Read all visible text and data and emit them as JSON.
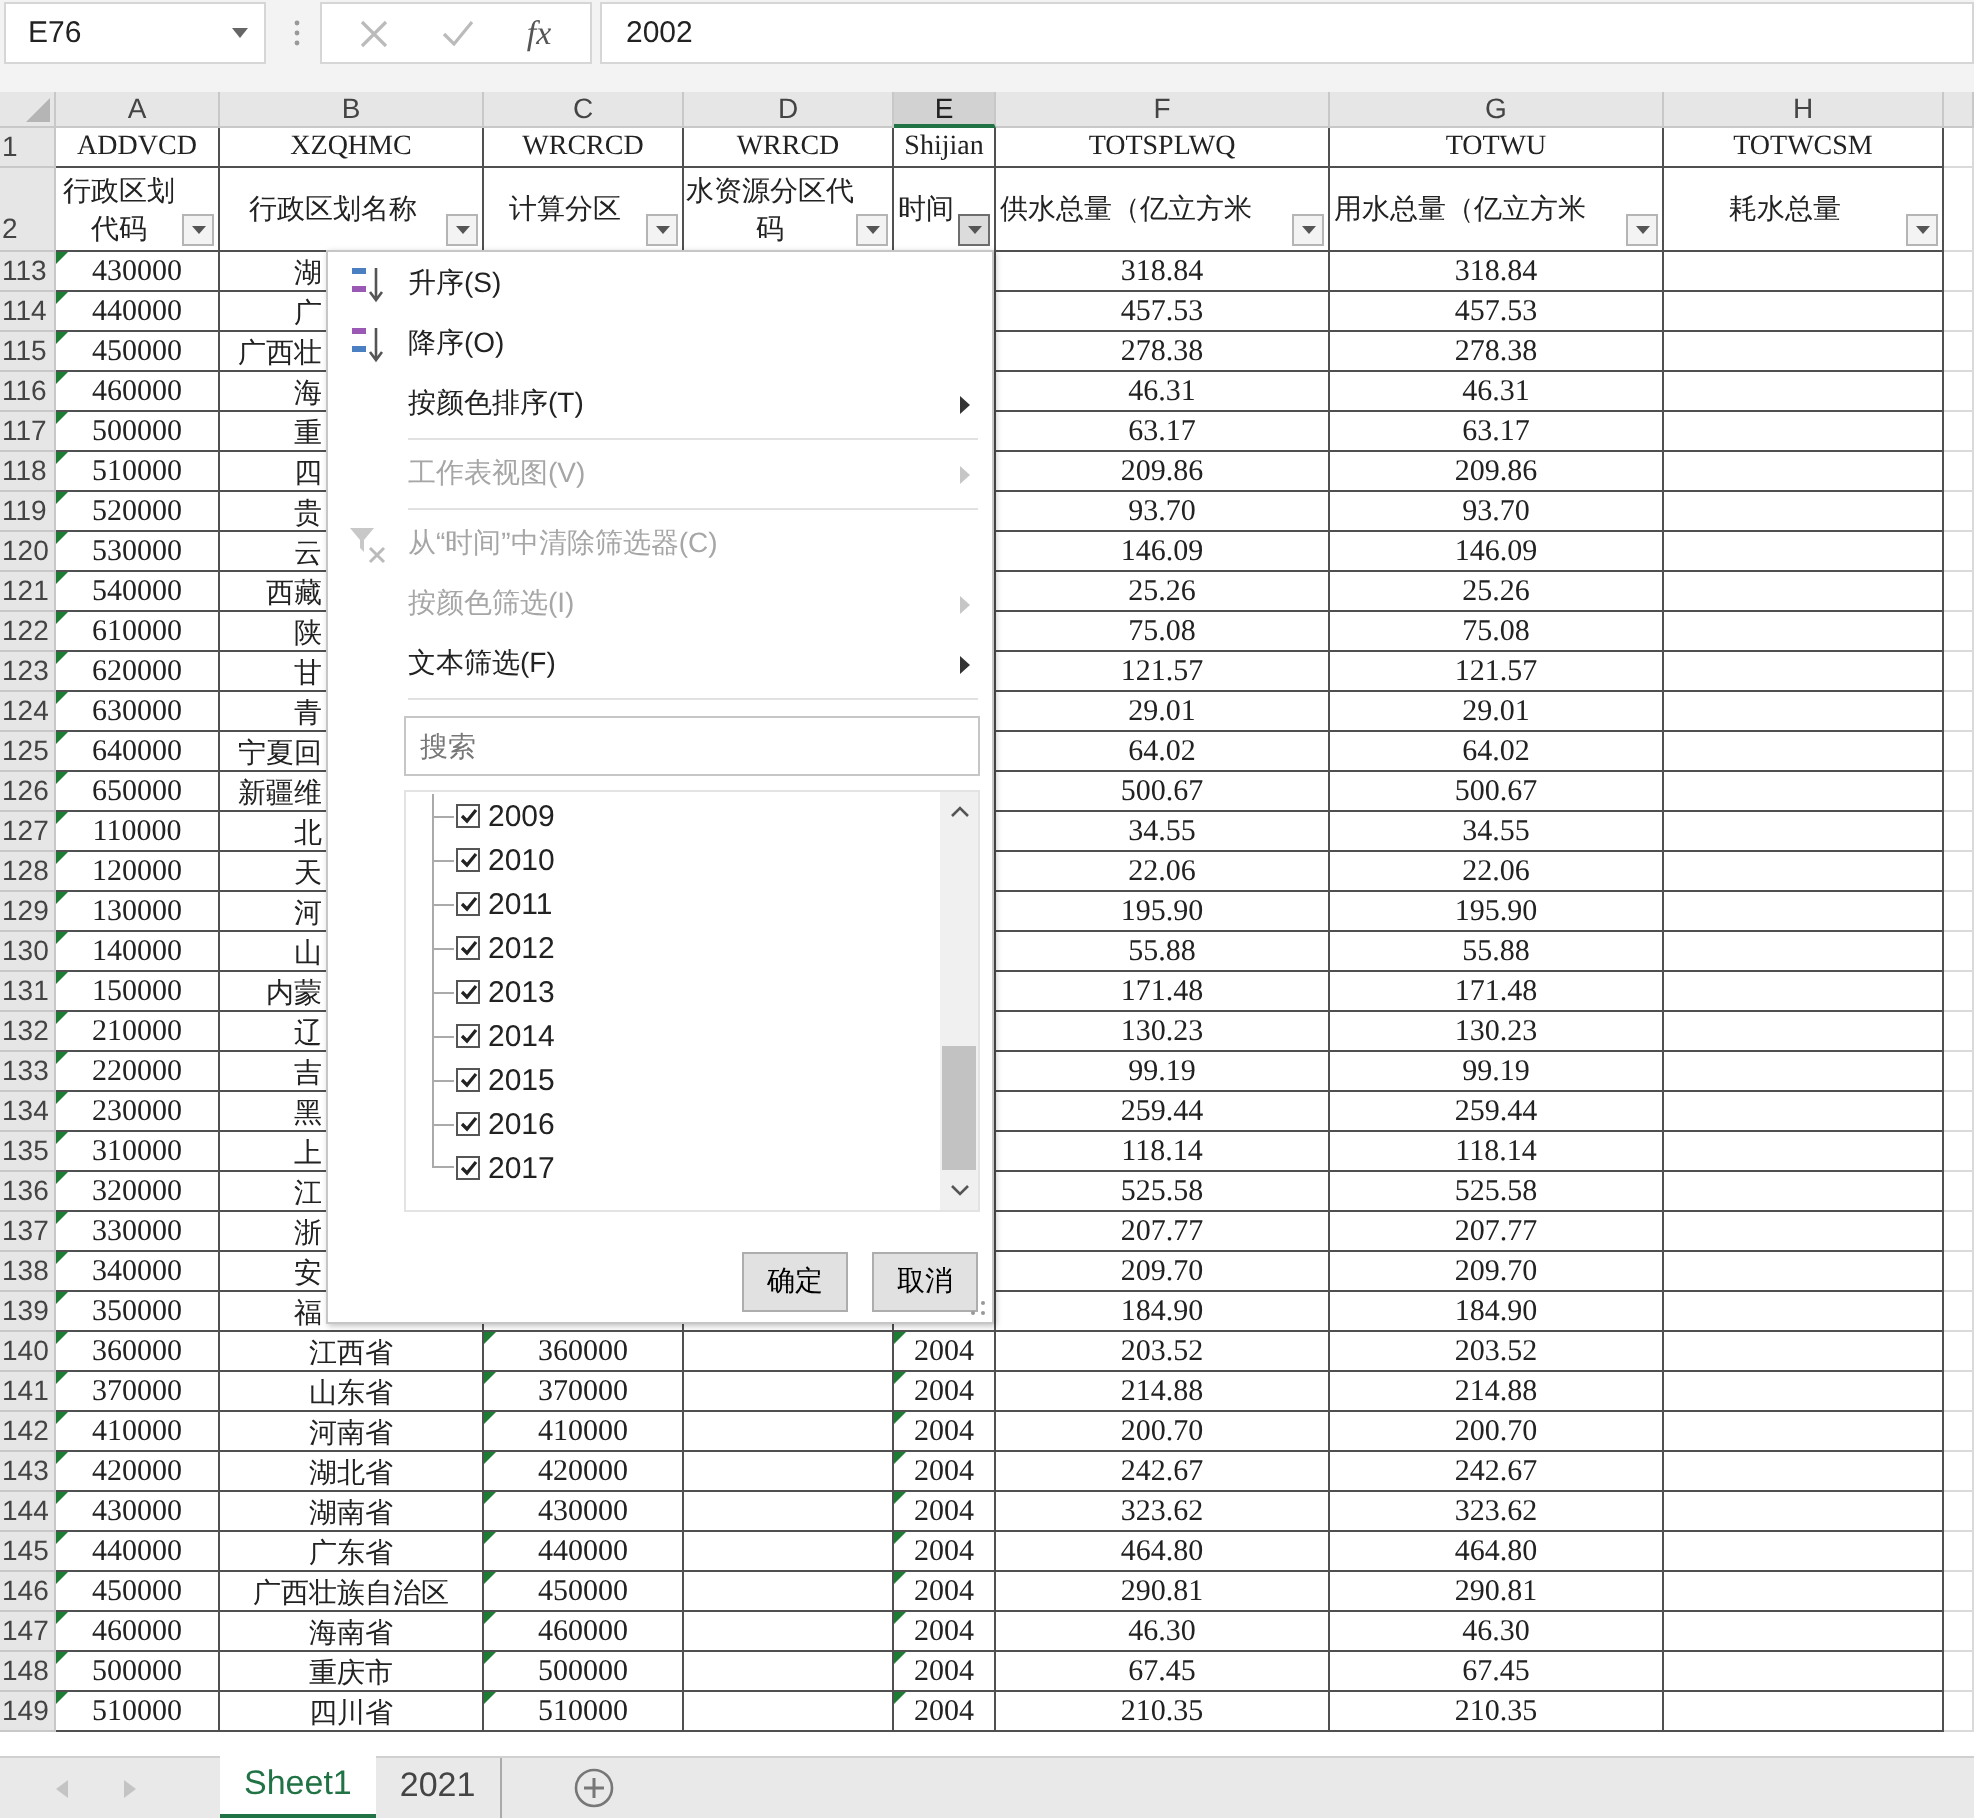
{
  "formula_bar": {
    "name_box": "E76",
    "fx": "fx",
    "formula": "2002"
  },
  "sheet": {
    "code_row_number": "1",
    "label_row_number": "2",
    "columns": [
      {
        "letter": "A",
        "code": "ADDVCD",
        "label": "行政区划代码",
        "selected": false,
        "filter_open": false,
        "stored_as_text": true
      },
      {
        "letter": "B",
        "code": "XZQHMC",
        "label": "行政区划名称",
        "selected": false,
        "filter_open": false,
        "stored_as_text": false
      },
      {
        "letter": "C",
        "code": "WRCRCD",
        "label": "计算分区",
        "selected": false,
        "filter_open": false,
        "stored_as_text": true
      },
      {
        "letter": "D",
        "code": "WRRCD",
        "label": "水资源分区代码",
        "selected": false,
        "filter_open": false
      },
      {
        "letter": "E",
        "code": "Shijian",
        "label": "时间",
        "selected": true,
        "filter_open": true,
        "stored_as_text": true
      },
      {
        "letter": "F",
        "code": "TOTSPLWQ",
        "label": "供水总量（亿立方米",
        "selected": false,
        "filter_open": false,
        "stored_as_text": false
      },
      {
        "letter": "G",
        "code": "TOTWU",
        "label": "用水总量（亿立方米",
        "selected": false,
        "filter_open": false,
        "stored_as_text": false
      },
      {
        "letter": "H",
        "code": "TOTWCSM",
        "label": "耗水总量",
        "selected": false,
        "filter_open": false
      }
    ],
    "rows": [
      {
        "n": "113",
        "cells": {
          "A": "430000",
          "B": "湖",
          "F": "318.84",
          "G": "318.84"
        }
      },
      {
        "n": "114",
        "cells": {
          "A": "440000",
          "B": "广",
          "F": "457.53",
          "G": "457.53"
        }
      },
      {
        "n": "115",
        "cells": {
          "A": "450000",
          "B": "广西壮",
          "F": "278.38",
          "G": "278.38"
        }
      },
      {
        "n": "116",
        "cells": {
          "A": "460000",
          "B": "海",
          "F": "46.31",
          "G": "46.31"
        }
      },
      {
        "n": "117",
        "cells": {
          "A": "500000",
          "B": "重",
          "F": "63.17",
          "G": "63.17"
        }
      },
      {
        "n": "118",
        "cells": {
          "A": "510000",
          "B": "四",
          "F": "209.86",
          "G": "209.86"
        }
      },
      {
        "n": "119",
        "cells": {
          "A": "520000",
          "B": "贵",
          "F": "93.70",
          "G": "93.70"
        }
      },
      {
        "n": "120",
        "cells": {
          "A": "530000",
          "B": "云",
          "F": "146.09",
          "G": "146.09"
        }
      },
      {
        "n": "121",
        "cells": {
          "A": "540000",
          "B": "西藏",
          "F": "25.26",
          "G": "25.26"
        }
      },
      {
        "n": "122",
        "cells": {
          "A": "610000",
          "B": "陕",
          "F": "75.08",
          "G": "75.08"
        }
      },
      {
        "n": "123",
        "cells": {
          "A": "620000",
          "B": "甘",
          "F": "121.57",
          "G": "121.57"
        }
      },
      {
        "n": "124",
        "cells": {
          "A": "630000",
          "B": "青",
          "F": "29.01",
          "G": "29.01"
        }
      },
      {
        "n": "125",
        "cells": {
          "A": "640000",
          "B": "宁夏回",
          "F": "64.02",
          "G": "64.02"
        }
      },
      {
        "n": "126",
        "cells": {
          "A": "650000",
          "B": "新疆维",
          "F": "500.67",
          "G": "500.67"
        }
      },
      {
        "n": "127",
        "cells": {
          "A": "110000",
          "B": "北",
          "F": "34.55",
          "G": "34.55"
        }
      },
      {
        "n": "128",
        "cells": {
          "A": "120000",
          "B": "天",
          "F": "22.06",
          "G": "22.06"
        }
      },
      {
        "n": "129",
        "cells": {
          "A": "130000",
          "B": "河",
          "F": "195.90",
          "G": "195.90"
        }
      },
      {
        "n": "130",
        "cells": {
          "A": "140000",
          "B": "山",
          "F": "55.88",
          "G": "55.88"
        }
      },
      {
        "n": "131",
        "cells": {
          "A": "150000",
          "B": "内蒙",
          "F": "171.48",
          "G": "171.48"
        }
      },
      {
        "n": "132",
        "cells": {
          "A": "210000",
          "B": "辽",
          "F": "130.23",
          "G": "130.23"
        }
      },
      {
        "n": "133",
        "cells": {
          "A": "220000",
          "B": "吉",
          "F": "99.19",
          "G": "99.19"
        }
      },
      {
        "n": "134",
        "cells": {
          "A": "230000",
          "B": "黑",
          "F": "259.44",
          "G": "259.44"
        }
      },
      {
        "n": "135",
        "cells": {
          "A": "310000",
          "B": "上",
          "F": "118.14",
          "G": "118.14"
        }
      },
      {
        "n": "136",
        "cells": {
          "A": "320000",
          "B": "江",
          "F": "525.58",
          "G": "525.58"
        }
      },
      {
        "n": "137",
        "cells": {
          "A": "330000",
          "B": "浙",
          "F": "207.77",
          "G": "207.77"
        }
      },
      {
        "n": "138",
        "cells": {
          "A": "340000",
          "B": "安",
          "F": "209.70",
          "G": "209.70"
        }
      },
      {
        "n": "139",
        "cells": {
          "A": "350000",
          "B": "福",
          "F": "184.90",
          "G": "184.90"
        }
      },
      {
        "n": "140",
        "cells": {
          "A": "360000",
          "B": "江西省",
          "C": "360000",
          "E": "2004",
          "F": "203.52",
          "G": "203.52"
        }
      },
      {
        "n": "141",
        "cells": {
          "A": "370000",
          "B": "山东省",
          "C": "370000",
          "E": "2004",
          "F": "214.88",
          "G": "214.88"
        }
      },
      {
        "n": "142",
        "cells": {
          "A": "410000",
          "B": "河南省",
          "C": "410000",
          "E": "2004",
          "F": "200.70",
          "G": "200.70"
        }
      },
      {
        "n": "143",
        "cells": {
          "A": "420000",
          "B": "湖北省",
          "C": "420000",
          "E": "2004",
          "F": "242.67",
          "G": "242.67"
        }
      },
      {
        "n": "144",
        "cells": {
          "A": "430000",
          "B": "湖南省",
          "C": "430000",
          "E": "2004",
          "F": "323.62",
          "G": "323.62"
        }
      },
      {
        "n": "145",
        "cells": {
          "A": "440000",
          "B": "广东省",
          "C": "440000",
          "E": "2004",
          "F": "464.80",
          "G": "464.80"
        }
      },
      {
        "n": "146",
        "cells": {
          "A": "450000",
          "B": "广西壮族自治区",
          "C": "450000",
          "E": "2004",
          "F": "290.81",
          "G": "290.81"
        }
      },
      {
        "n": "147",
        "cells": {
          "A": "460000",
          "B": "海南省",
          "C": "460000",
          "E": "2004",
          "F": "46.30",
          "G": "46.30"
        }
      },
      {
        "n": "148",
        "cells": {
          "A": "500000",
          "B": "重庆市",
          "C": "500000",
          "E": "2004",
          "F": "67.45",
          "G": "67.45"
        }
      },
      {
        "n": "149",
        "cells": {
          "A": "510000",
          "B": "四川省",
          "C": "510000",
          "E": "2004",
          "F": "210.35",
          "G": "210.35"
        }
      }
    ]
  },
  "filter_menu": {
    "items": [
      {
        "kind": "sort_asc",
        "label": "升序(S)",
        "disabled": false
      },
      {
        "kind": "sort_desc",
        "label": "降序(O)",
        "disabled": false
      },
      {
        "kind": "submenu",
        "label": "按颜色排序(T)",
        "disabled": false
      },
      {
        "kind": "separator"
      },
      {
        "kind": "submenu",
        "label": "工作表视图(V)",
        "disabled": true
      },
      {
        "kind": "separator"
      },
      {
        "kind": "clear_filter",
        "label": "从“时间”中清除筛选器(C)",
        "disabled": true
      },
      {
        "kind": "submenu",
        "label": "按颜色筛选(I)",
        "disabled": true
      },
      {
        "kind": "submenu",
        "label": "文本筛选(F)",
        "disabled": false
      },
      {
        "kind": "separator"
      }
    ],
    "search": {
      "placeholder": "搜索"
    },
    "values": [
      {
        "label": "2009",
        "checked": true
      },
      {
        "label": "2010",
        "checked": true
      },
      {
        "label": "2011",
        "checked": true
      },
      {
        "label": "2012",
        "checked": true
      },
      {
        "label": "2013",
        "checked": true
      },
      {
        "label": "2014",
        "checked": true
      },
      {
        "label": "2015",
        "checked": true
      },
      {
        "label": "2016",
        "checked": true
      },
      {
        "label": "2017",
        "checked": true
      }
    ],
    "buttons": [
      "确定",
      "取消"
    ]
  },
  "sheet_tabs": [
    {
      "label": "Sheet1",
      "selected": true
    },
    {
      "label": "2021",
      "selected": false
    }
  ]
}
